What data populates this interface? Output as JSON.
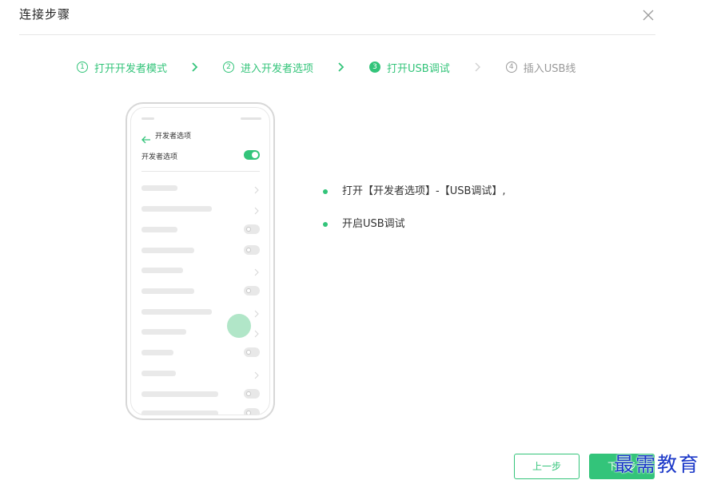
{
  "dialog": {
    "title": "连接步骤"
  },
  "steps": [
    {
      "num": "1",
      "label": "打开开发者模式",
      "state": "done"
    },
    {
      "num": "2",
      "label": "进入开发者选项",
      "state": "done"
    },
    {
      "num": "3",
      "label": "打开USB调试",
      "state": "current"
    },
    {
      "num": "4",
      "label": "插入USB线",
      "state": "todo"
    }
  ],
  "phone": {
    "title": "开发者选项",
    "row_label": "开发者选项",
    "toggle_on": true
  },
  "instructions": [
    "打开【开发者选项】-【USB调试】,",
    "开启USB调试"
  ],
  "buttons": {
    "prev": "上一步",
    "next": "下一步"
  },
  "watermark": "最需教育",
  "colors": {
    "accent": "#33c47a",
    "inactive": "#9a9a9a"
  }
}
